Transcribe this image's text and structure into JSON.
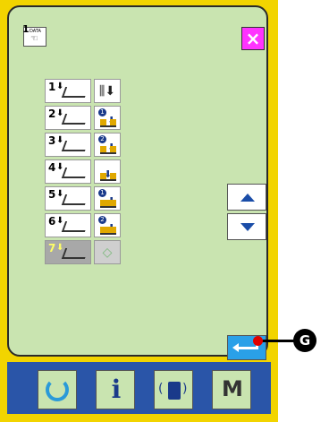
{
  "header": {
    "data_icon_number": "1",
    "data_icon_label": "DATA",
    "close_label": "×"
  },
  "rows": [
    {
      "number": "1",
      "action": "thread-trimmer-vertical"
    },
    {
      "number": "2",
      "action": "wiper-1"
    },
    {
      "number": "3",
      "action": "wiper-2"
    },
    {
      "number": "4",
      "action": "trim-down"
    },
    {
      "number": "5",
      "action": "clamp-1"
    },
    {
      "number": "6",
      "action": "clamp-2"
    },
    {
      "number": "7",
      "action": "start",
      "disabled": true
    }
  ],
  "callout": {
    "label": "G"
  },
  "bottom_nav": {
    "info_label": "i",
    "mode_label": "M"
  },
  "colors": {
    "screen_bg": "#c9e4b0",
    "panel_frame": "#f2d400",
    "close_button": "#ff33ff",
    "enter_button": "#2aa0e8",
    "nav_bar": "#2a55a8"
  }
}
